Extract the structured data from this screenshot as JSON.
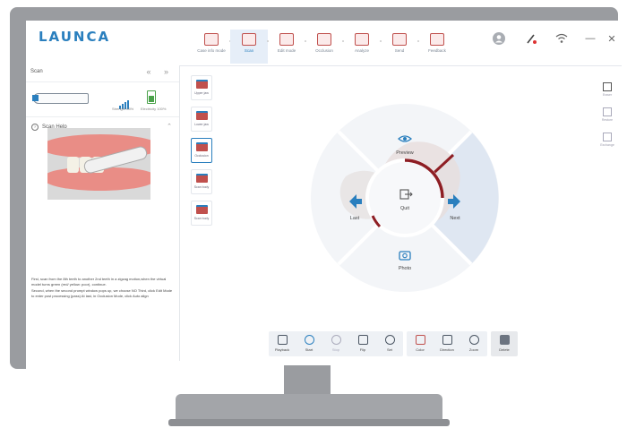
{
  "app": {
    "logo": "LAUNCA"
  },
  "tabs": [
    {
      "label": "Case info mode",
      "icon": "case-info-icon",
      "active": false
    },
    {
      "label": "Scan",
      "icon": "scan-icon",
      "active": true
    },
    {
      "label": "Edit mode",
      "icon": "edit-mode-icon",
      "active": false
    },
    {
      "label": "Occlusion",
      "icon": "occlusion-icon",
      "active": false
    },
    {
      "label": "Analyze",
      "icon": "analyze-icon",
      "active": false
    },
    {
      "label": "Send",
      "icon": "send-icon",
      "active": false
    },
    {
      "label": "Feedback",
      "icon": "feedback-icon",
      "active": false
    }
  ],
  "window_controls": {
    "minimize": "—",
    "close": "✕"
  },
  "left_panel": {
    "title": "Scan",
    "nav": "«   »",
    "device": {
      "signal_label": "Strength 85%",
      "battery_label": "Electricity 100%"
    },
    "help": {
      "title": "Scan Help",
      "instructions": [
        "First, scan from the 8th teeth to another 2nd teeth in a zigzag motion,when the virtual model turns green (red/ yellow: poor), continue.",
        "Second, when the second prompt window pops up, we choose NO Third, click Edit Mode to enter post processing (pass) At last, in Occlusion Mode, click Auto align"
      ]
    }
  },
  "scan_tools": [
    {
      "label": "Upper jaw",
      "active": false
    },
    {
      "label": "Lower jaw",
      "active": false
    },
    {
      "label": "Occlusion",
      "active": true
    },
    {
      "label": "Scan body",
      "active": false
    },
    {
      "label": "Scan body",
      "active": false
    }
  ],
  "right_tools": [
    {
      "label": "Eraser",
      "icon": "eraser-icon"
    },
    {
      "label": "Restore",
      "icon": "restore-icon"
    },
    {
      "label": "Exchange",
      "icon": "exchange-icon"
    }
  ],
  "wheel": {
    "top": "Preview",
    "left": "Last",
    "right": "Next",
    "bottom": "Photo",
    "center": "Quit"
  },
  "bottom_toolbar": {
    "group1": [
      {
        "label": "Playback",
        "disabled": false
      },
      {
        "label": "Start",
        "disabled": false
      },
      {
        "label": "Stop",
        "disabled": true
      },
      {
        "label": "Flip",
        "disabled": false
      },
      {
        "label": "Set",
        "disabled": false
      }
    ],
    "group2": [
      {
        "label": "Color",
        "disabled": false
      },
      {
        "label": "Direction",
        "disabled": false
      },
      {
        "label": "Zoom",
        "disabled": false
      }
    ],
    "delete": {
      "label": "Delete",
      "disabled": false
    }
  },
  "colors": {
    "accent": "#2a7fbe",
    "tooth_red": "#c0504d",
    "bezel": "#9a9ca0"
  }
}
